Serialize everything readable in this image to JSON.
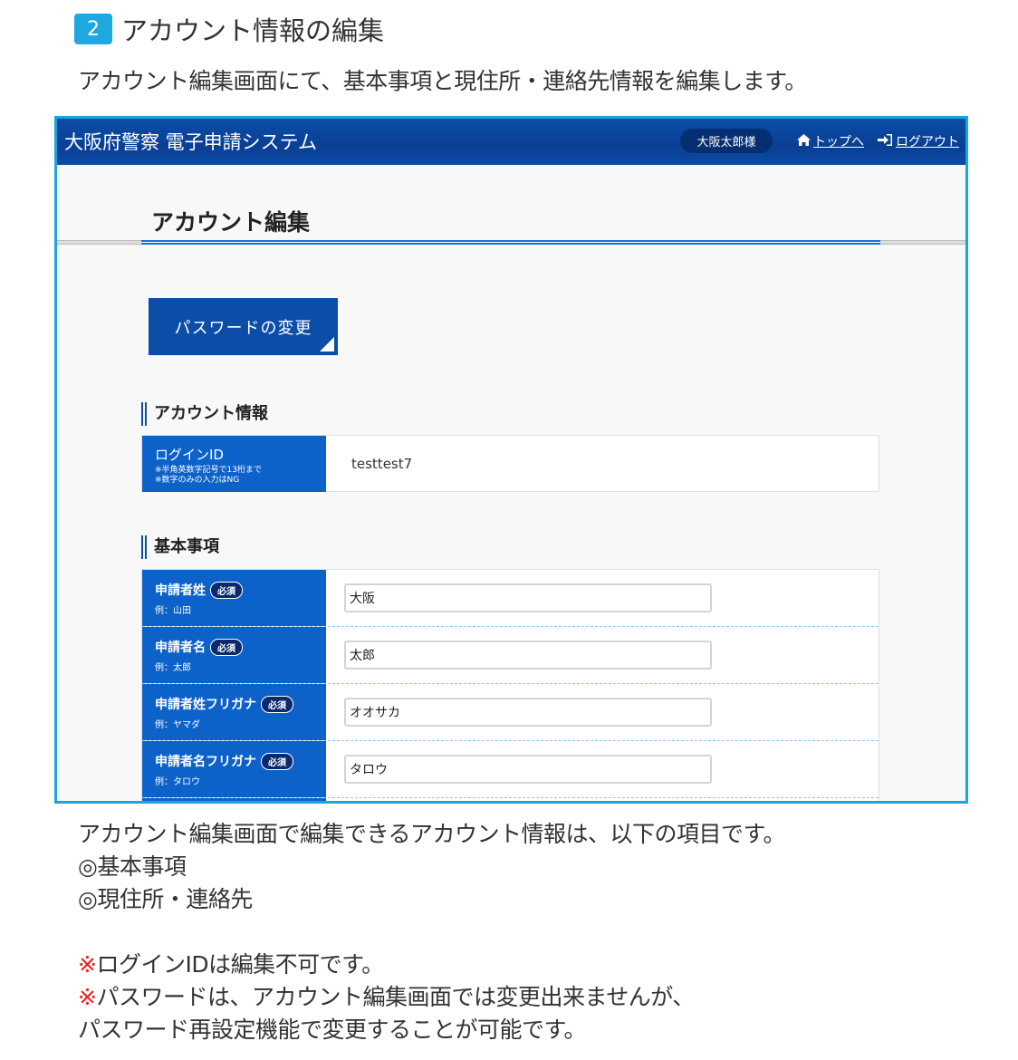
{
  "step": {
    "number": "2",
    "title": "アカウント情報の編集"
  },
  "intro": "アカウント編集画面にて、基本事項と現住所・連絡先情報を編集します。",
  "app": {
    "title": "大阪府警察 電子申請システム",
    "user": "大阪太郎様",
    "nav_top": "トップへ",
    "nav_logout": "ログアウト"
  },
  "page": {
    "title": "アカウント編集",
    "password_button": "パスワードの変更"
  },
  "account_section": {
    "heading": "アカウント情報",
    "login_id_label": "ログインID",
    "login_id_note1": "※半角英数字記号で13桁まで",
    "login_id_note2": "※数字のみの入力はNG",
    "login_id_value": "testtest7"
  },
  "basic_section": {
    "heading": "基本事項",
    "required_badge": "必須",
    "fields": [
      {
        "label": "申請者姓",
        "example": "例：山田",
        "value": "大阪"
      },
      {
        "label": "申請者名",
        "example": "例：太郎",
        "value": "太郎"
      },
      {
        "label": "申請者姓フリガナ",
        "example": "例：ヤマダ",
        "value": "オオサカ"
      },
      {
        "label": "申請者名フリガナ",
        "example": "例：タロウ",
        "value": "タロウ"
      }
    ]
  },
  "notes": {
    "line1": "アカウント編集画面で編集できるアカウント情報は、以下の項目です。",
    "line2": "◎基本事項",
    "line3": "◎現住所・連絡先",
    "mark": "※",
    "warn1": "ログインIDは編集不可です。",
    "warn2": "パスワードは、アカウント編集画面では変更出来ませんが、",
    "warn3": "パスワード再設定機能で変更することが可能です。"
  },
  "colors": {
    "accent": "#1ea4dd",
    "header_blue": "#0b4da8",
    "label_blue": "#0d62c9",
    "warning_red": "#e8211b"
  }
}
